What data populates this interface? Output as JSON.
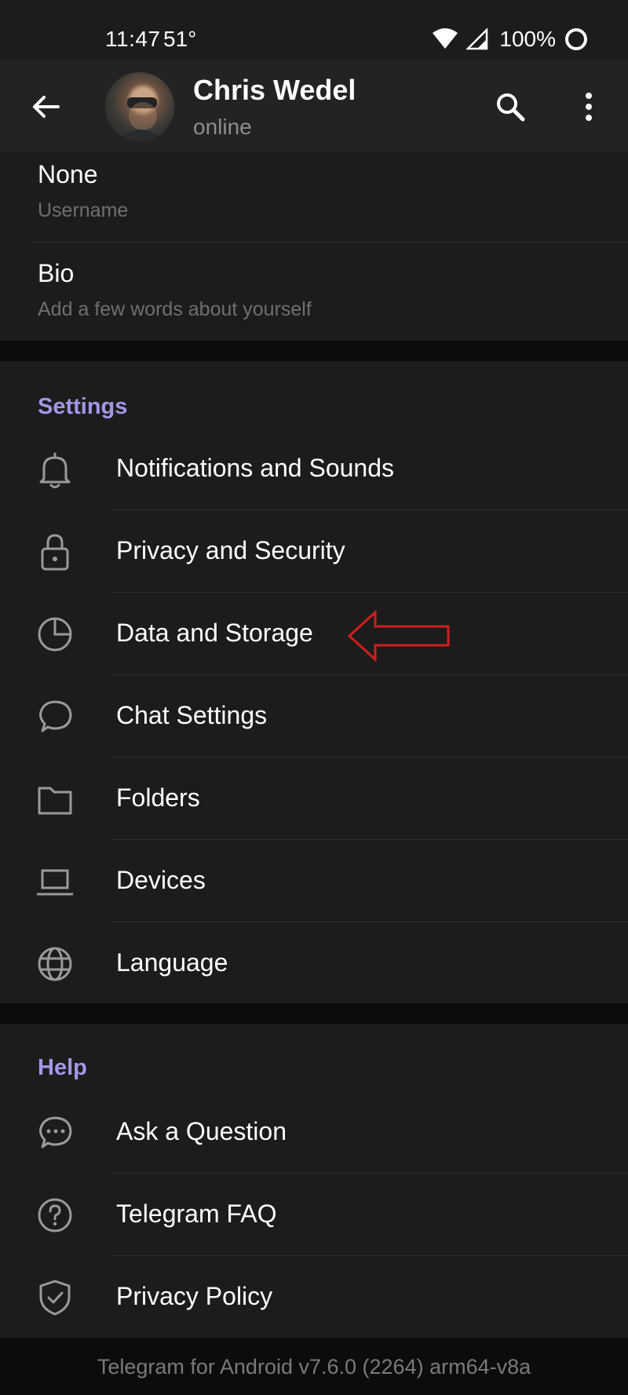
{
  "status_bar": {
    "time": "11:47",
    "temperature": "51°",
    "battery": "100%",
    "icons": [
      "wifi-icon",
      "signal-icon",
      "battery-icon"
    ]
  },
  "app_bar": {
    "name": "Chris Wedel",
    "status": "online",
    "icons": [
      "back-arrow-icon",
      "search-icon",
      "more-vertical-icon"
    ]
  },
  "account": [
    {
      "value": "None",
      "caption": "Username"
    },
    {
      "value": "Bio",
      "caption": "Add a few words about yourself"
    }
  ],
  "settings": {
    "title": "Settings",
    "items": [
      {
        "label": "Notifications and Sounds",
        "icon": "bell-icon"
      },
      {
        "label": "Privacy and Security",
        "icon": "lock-icon"
      },
      {
        "label": "Data and Storage",
        "icon": "pie-chart-icon"
      },
      {
        "label": "Chat Settings",
        "icon": "chat-bubble-icon"
      },
      {
        "label": "Folders",
        "icon": "folder-icon"
      },
      {
        "label": "Devices",
        "icon": "laptop-icon"
      },
      {
        "label": "Language",
        "icon": "globe-icon"
      }
    ]
  },
  "help": {
    "title": "Help",
    "items": [
      {
        "label": "Ask a Question",
        "icon": "chat-dots-icon"
      },
      {
        "label": "Telegram FAQ",
        "icon": "question-circle-icon"
      },
      {
        "label": "Privacy Policy",
        "icon": "shield-check-icon"
      }
    ]
  },
  "footer": {
    "version": "Telegram for Android v7.6.0 (2264) arm64-v8a"
  },
  "colors": {
    "accent": "#a695e7",
    "background": "#1c1c1c",
    "annotation": "#d11e1e"
  }
}
